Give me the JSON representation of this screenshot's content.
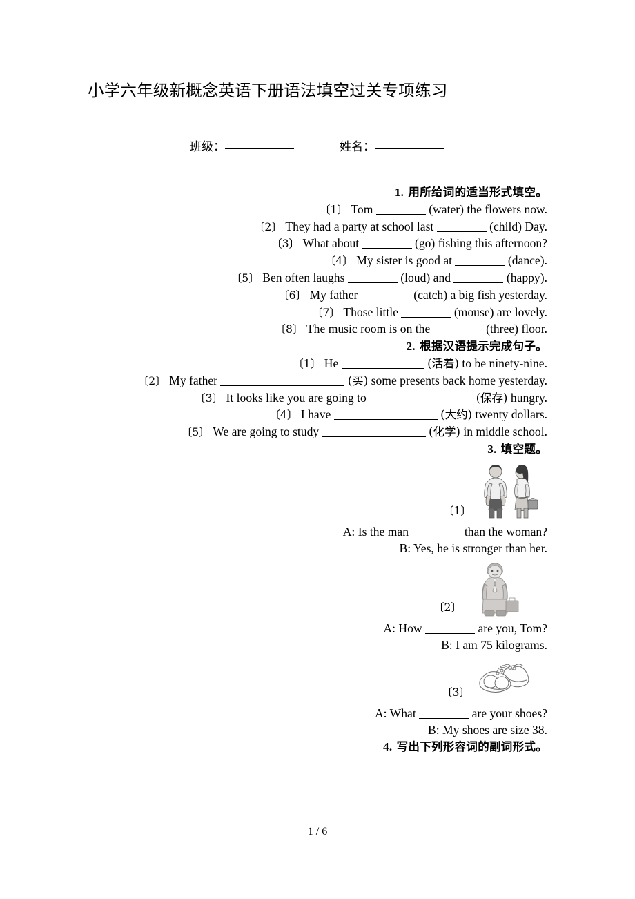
{
  "document": {
    "title": "小学六年级新概念英语下册语法填空过关专项练习",
    "class_label": "班级：",
    "name_label": "姓名：",
    "page_footer": "1 / 6"
  },
  "sections": [
    {
      "heading_num": "1.",
      "heading_text": "用所给词的适当形式填空。",
      "items": [
        {
          "idx": "〔1〕",
          "pre": "Tom",
          "post": "(water) the flowers now."
        },
        {
          "idx": "〔2〕",
          "pre": "They had a party at school last",
          "post": "(child) Day."
        },
        {
          "idx": "〔3〕",
          "pre": "What about",
          "post": "(go) fishing this afternoon?"
        },
        {
          "idx": "〔4〕",
          "pre": "My sister is good at",
          "post": "(dance)."
        },
        {
          "idx": "〔5〕",
          "pre": "Ben often laughs",
          "mid": "(loud) and",
          "post": "(happy)."
        },
        {
          "idx": "〔6〕",
          "pre": "My father",
          "post": "(catch) a big fish yesterday."
        },
        {
          "idx": "〔7〕",
          "pre": "Those little",
          "post": "(mouse) are lovely."
        },
        {
          "idx": "〔8〕",
          "pre": "The music room is on the",
          "post": "(three) floor."
        }
      ]
    },
    {
      "heading_num": "2.",
      "heading_text": "根据汉语提示完成句子。",
      "items": [
        {
          "idx": "〔1〕",
          "pre": "He",
          "hint": "(活着)",
          "post": "to be ninety-nine."
        },
        {
          "idx": "〔2〕",
          "pre": "My father",
          "hint": "(买)",
          "post": "some presents back home yesterday."
        },
        {
          "idx": "〔3〕",
          "pre": "It looks like you are going to",
          "hint": "(保存)",
          "post": "hungry."
        },
        {
          "idx": "〔4〕",
          "pre": "I have",
          "hint": "(大约)",
          "post": "twenty dollars."
        },
        {
          "idx": "〔5〕",
          "pre": "We are going to study",
          "hint": "(化学)",
          "post": "in middle school."
        }
      ]
    },
    {
      "heading_num": "3.",
      "heading_text": "填空题。",
      "picture_items": [
        {
          "idx": "〔1〕",
          "image": "man-and-woman-illustration",
          "question": "A: Is the man",
          "question_tail": "than the woman?",
          "answer": "B: Yes, he is stronger than her."
        },
        {
          "idx": "〔2〕",
          "image": "man-with-briefcase-illustration",
          "question": "A: How",
          "question_tail": "are you, Tom?",
          "answer": "B: I am 75 kilograms."
        },
        {
          "idx": "〔3〕",
          "image": "pair-of-shoes-illustration",
          "question": "A: What",
          "question_tail": "are your shoes?",
          "answer": "B: My shoes are size 38."
        }
      ]
    },
    {
      "heading_num": "4.",
      "heading_text": "写出下列形容词的副词形式。"
    }
  ]
}
